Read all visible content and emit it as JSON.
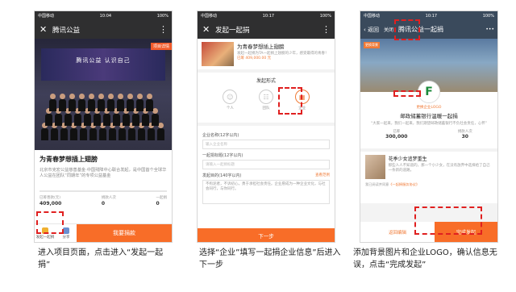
{
  "phone1": {
    "status": {
      "carrier": "中国移动",
      "time": "10:04",
      "battery": "100%"
    },
    "title": "腾讯公益",
    "photo_banner": "腾讯公益 认识自己",
    "photo_tag": "项目详情",
    "project_title": "为青春梦想插上翅膀",
    "description": "北京市克宏公益慈善基金·中国残障中心联合发起，是中国首个全球华人公益在团队“同期年”的专项公益基金",
    "stats": {
      "raised_label": "已筹善款(元)",
      "raised_value": "409,000",
      "donors_label": "捐款人次",
      "donors_value": "0",
      "teams_label": "一起捐",
      "teams_value": "0"
    },
    "footer": {
      "together_label": "发起一起捐",
      "share_label": "分享",
      "donate_label": "我要捐款"
    }
  },
  "phone2": {
    "status": {
      "carrier": "中国移动",
      "time": "10:17",
      "battery": "100%"
    },
    "title": "发起一起捐",
    "card_title": "为青春梦想插上翅膀",
    "card_desc": "发起一起捐为TA一起捐上翅膀的少年，感受最得的青春！",
    "card_amount": "已筹 409,000.00 元",
    "section_title": "发起形式",
    "options": [
      {
        "label": "个人",
        "icon": "person-icon"
      },
      {
        "label": "团队",
        "icon": "team-icon"
      },
      {
        "label": "企业",
        "icon": "company-icon"
      }
    ],
    "form": {
      "company_label": "企业名称(12字以内)",
      "company_placeholder": "输入企业名称",
      "slogan_label": "一起捐标题(12字以内)",
      "slogan_placeholder": "请输入一起捐标题",
      "intro_label": "发起目的(140字以内)",
      "intro_link": "查看范例",
      "intro_text": "不拘泥者，不诉初心，勇于承担社会责任。企业愿成为一种企业文化，与社会同行，与你同行。"
    },
    "next_button": "下一步"
  },
  "phone3": {
    "status": {
      "carrier": "中国移动",
      "time": "10:17",
      "battery": "100%"
    },
    "back_label": "返回",
    "close_label": "关闭",
    "title": "腾讯公益一起捐",
    "hero_tag": "更换背景",
    "logo_glyph": "F",
    "small_label": "更换企业LOGO",
    "name": "邮政储蓄银行温暖一起捐",
    "quote": "“大家一起来，我们一起来，我们期望邮政储蓄银行不负社会责任，心怀”",
    "stats": {
      "raised_label": "已筹",
      "raised_value": "300,000",
      "donors_label": "捐款人次",
      "donors_value": "30"
    },
    "card_title": "花季少女追梦重生",
    "card_desc": "那些人人不知道的，那一个小少女，在没有放弃中选择给了自己一条新的道路。",
    "agree_text": "我已阅读并同意",
    "agree_link": "《一起捐服务协议》",
    "back_edit": "返回编辑",
    "finish_button": "完成发起"
  },
  "captions": {
    "step1": "进入项目页面，点击进入“发起一起捐”",
    "step2": "选择“企业”填写一起捐企业信息”后进入下一步",
    "step3": "添加背景图片和企业LOGO，确认信息无误，点击“完成发起”"
  },
  "colors": {
    "accent": "#f86d28",
    "highlight": "#e02020"
  }
}
